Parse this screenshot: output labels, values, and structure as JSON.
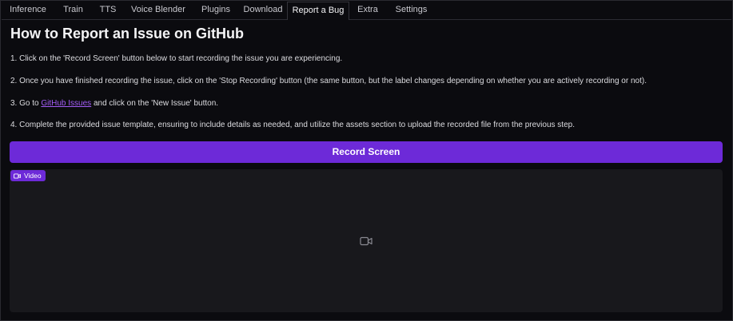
{
  "tabs": [
    {
      "label": "Inference"
    },
    {
      "label": "Train"
    },
    {
      "label": "TTS"
    },
    {
      "label": "Voice Blender"
    },
    {
      "label": "Plugins"
    },
    {
      "label": "Download"
    },
    {
      "label": "Report a Bug"
    },
    {
      "label": "Extra"
    },
    {
      "label": "Settings"
    }
  ],
  "active_tab": "Report a Bug",
  "page": {
    "title": "How to Report an Issue on GitHub",
    "steps": {
      "step1": "1. Click on the 'Record Screen' button below to start recording the issue you are experiencing.",
      "step2": "2. Once you have finished recording the issue, click on the 'Stop Recording' button (the same button, but the label changes depending on whether you are actively recording or not).",
      "step3_prefix": "3. Go to ",
      "step3_link": "GitHub Issues",
      "step3_suffix": " and click on the 'New Issue' button.",
      "step4": "4. Complete the provided issue template, ensuring to include details as needed, and utilize the assets section to upload the recorded file from the previous step."
    }
  },
  "record_button": {
    "label": "Record Screen"
  },
  "video": {
    "badge_label": "Video",
    "badge_icon": "video-camera-icon",
    "placeholder_icon": "video-camera-icon"
  },
  "colors": {
    "accent": "#6d2ad8",
    "link": "#a35cf6",
    "background": "#0b0b0f",
    "panel": "#18181c"
  }
}
